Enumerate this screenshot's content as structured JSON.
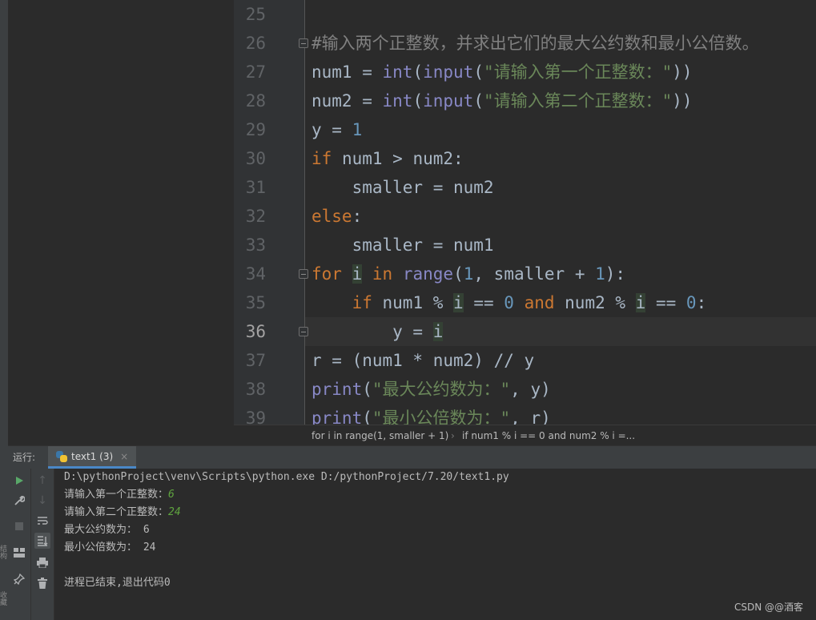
{
  "gutter": {
    "lines": [
      "25",
      "26",
      "27",
      "28",
      "29",
      "30",
      "31",
      "32",
      "33",
      "34",
      "35",
      "36",
      "37",
      "38",
      "39"
    ],
    "current": "36"
  },
  "code": {
    "l26_comment": "#输入两个正整数，并求出它们的最大公约数和最小公倍数。",
    "l27_var": "num1",
    "l27_eq": " = ",
    "l27_int": "int",
    "l27_p1": "(",
    "l27_input": "input",
    "l27_p2": "(",
    "l27_str": "\"请输入第一个正整数：\"",
    "l27_p3": "))",
    "l28_var": "num2",
    "l28_eq": " = ",
    "l28_int": "int",
    "l28_p1": "(",
    "l28_input": "input",
    "l28_p2": "(",
    "l28_str": "\"请输入第二个正整数：\"",
    "l28_p3": "))",
    "l29_var": "y = ",
    "l29_num": "1",
    "l30_kw": "if",
    "l30_rest": " num1 > num2:",
    "l31_text": "    smaller = num2",
    "l32_kw": "else",
    "l32_rest": ":",
    "l33_text": "    smaller = num1",
    "l34_kw1": "for",
    "l34_sp1": " ",
    "l34_i": "i",
    "l34_sp2": " ",
    "l34_kw2": "in",
    "l34_sp3": " ",
    "l34_range": "range",
    "l34_p1": "(",
    "l34_n1": "1",
    "l34_mid": ", smaller + ",
    "l34_n2": "1",
    "l34_end": "):",
    "l35_indent": "    ",
    "l35_kw1": "if",
    "l35_a": " num1 % ",
    "l35_i1": "i",
    "l35_b": " == ",
    "l35_n0a": "0",
    "l35_sp": " ",
    "l35_kw2": "and",
    "l35_c": " num2 % ",
    "l35_i2": "i",
    "l35_d": " == ",
    "l35_n0b": "0",
    "l35_e": ":",
    "l36_indent": "        y = ",
    "l36_i": "i",
    "l37_text": "r = (num1 * num2) // y",
    "l38_print": "print",
    "l38_p": "(",
    "l38_str": "\"最大公约数为：\"",
    "l38_rest": ", y)",
    "l39_print": "print",
    "l39_p": "(",
    "l39_str": "\"最小公倍数为：\"",
    "l39_rest": ", r)"
  },
  "breadcrumb": {
    "item1": "for i in range(1, smaller + 1)",
    "sep": "›",
    "item2": "if num1 % i == 0 and num2 % i =..."
  },
  "run": {
    "label": "运行:",
    "tab_name": "text1 (3)",
    "close": "×"
  },
  "console": {
    "cmd": "D:\\pythonProject\\venv\\Scripts\\python.exe D:/pythonProject/7.20/text1.py",
    "prompt1": "请输入第一个正整数：",
    "input1": "6",
    "prompt2": "请输入第二个正整数：",
    "input2": "24",
    "out1": "最大公约数为： 6",
    "out2": "最小公倍数为： 24",
    "exit": "进程已结束,退出代码0"
  },
  "watermark": "CSDN @@酒客",
  "colors": {
    "background": "#2b2b2b",
    "keyword": "#cc7832",
    "builtin": "#8888c6",
    "string": "#6a8759",
    "number": "#6897bb",
    "comment": "#808080",
    "input_echo": "#5fa33f"
  }
}
